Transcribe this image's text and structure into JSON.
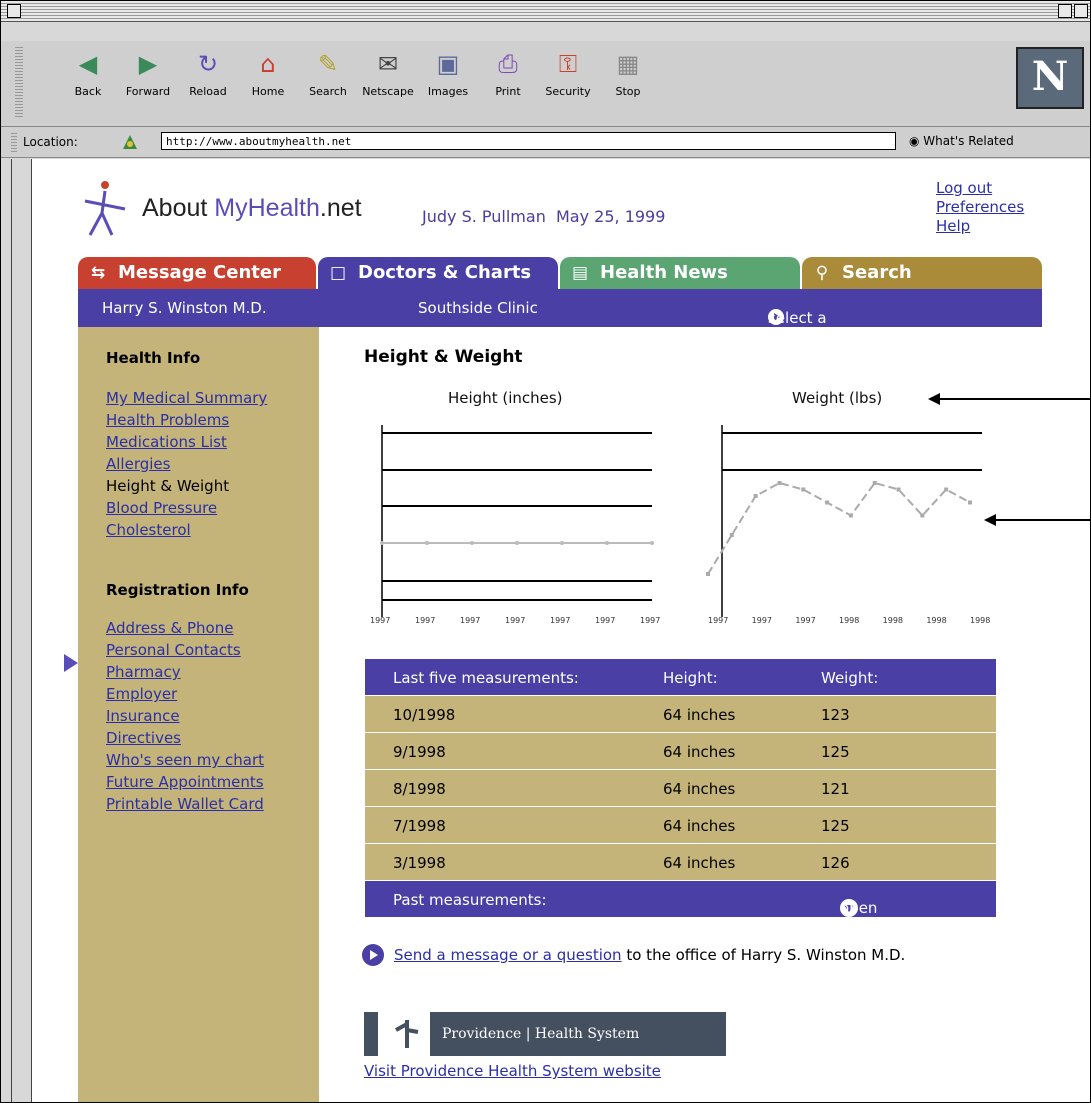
{
  "browser": {
    "toolbar": [
      {
        "label": "Back",
        "icon": "back-icon"
      },
      {
        "label": "Forward",
        "icon": "forward-icon"
      },
      {
        "label": "Reload",
        "icon": "reload-icon"
      },
      {
        "label": "Home",
        "icon": "home-icon"
      },
      {
        "label": "Search",
        "icon": "search-icon"
      },
      {
        "label": "Netscape",
        "icon": "netscape-icon"
      },
      {
        "label": "Images",
        "icon": "images-icon"
      },
      {
        "label": "Print",
        "icon": "print-icon"
      },
      {
        "label": "Security",
        "icon": "security-icon"
      },
      {
        "label": "Stop",
        "icon": "stop-icon"
      }
    ],
    "logo_letter": "N",
    "location_label": "Location:",
    "url": "http://www.aboutmyhealth.net",
    "related_label": "What's Related"
  },
  "site": {
    "name_a": "About",
    "name_b": "MyHealth",
    "name_c": ".net",
    "user": "Judy S. Pullman",
    "date": "May 25, 1999",
    "links": [
      "Log out",
      "Preferences",
      "Help"
    ]
  },
  "tabs": [
    {
      "label": "Message Center",
      "color": "#c8402f"
    },
    {
      "label": "Doctors & Charts",
      "color": "#4a3fa5"
    },
    {
      "label": "Health News",
      "color": "#5aa572"
    },
    {
      "label": "Search",
      "color": "#a98b3a"
    }
  ],
  "subbar": {
    "doctor": "Harry S. Winston M.D.",
    "clinic": "Southside Clinic",
    "action": "select a different chart"
  },
  "sidebar": {
    "health_heading": "Health Info",
    "health_items": [
      "My Medical Summary",
      "Health Problems",
      "Medications List",
      "Allergies",
      "Height & Weight",
      "Blood Pressure",
      "Cholesterol"
    ],
    "current": "Height & Weight",
    "reg_heading": "Registration Info",
    "reg_items": [
      "Address & Phone",
      "Personal Contacts",
      "Pharmacy",
      "Employer",
      "Insurance",
      "Directives",
      "Who's seen my chart",
      "Future Appointments",
      "Printable Wallet Card"
    ]
  },
  "main": {
    "title": "Height & Weight",
    "height_chart_title": "Height (inches)",
    "weight_chart_title": "Weight (lbs)"
  },
  "chart_data": [
    {
      "type": "line",
      "title": "Height (inches)",
      "x": [
        "1997",
        "1997",
        "1997",
        "1997",
        "1997",
        "1997",
        "1997"
      ],
      "series": [
        {
          "values": [
            64,
            64,
            64,
            64,
            64,
            64,
            64
          ]
        }
      ]
    },
    {
      "type": "line",
      "title": "Weight (lbs)",
      "x": [
        "1997",
        "1997",
        "1997",
        "1998",
        "1998",
        "1998",
        "1998"
      ],
      "series": [
        {
          "values": [
            112,
            118,
            124,
            126,
            125,
            123,
            121,
            126,
            125,
            121,
            125,
            123
          ]
        }
      ]
    }
  ],
  "table": {
    "headers": [
      "Last five measurements:",
      "Height:",
      "Weight:"
    ],
    "rows": [
      [
        "10/1998",
        "64 inches",
        "123"
      ],
      [
        "9/1998",
        "64 inches",
        "125"
      ],
      [
        "8/1998",
        "64 inches",
        "121"
      ],
      [
        "7/1998",
        "64 inches",
        "125"
      ],
      [
        "3/1998",
        "64 inches",
        "126"
      ]
    ],
    "footer_label": "Past measurements:",
    "footer_action": "open this list"
  },
  "message": {
    "link": "Send a message or a question",
    "rest": "to the office of Harry S. Winston M.D."
  },
  "provider": {
    "brand": "Providence | Health System",
    "link": "Visit Providence Health System website"
  }
}
